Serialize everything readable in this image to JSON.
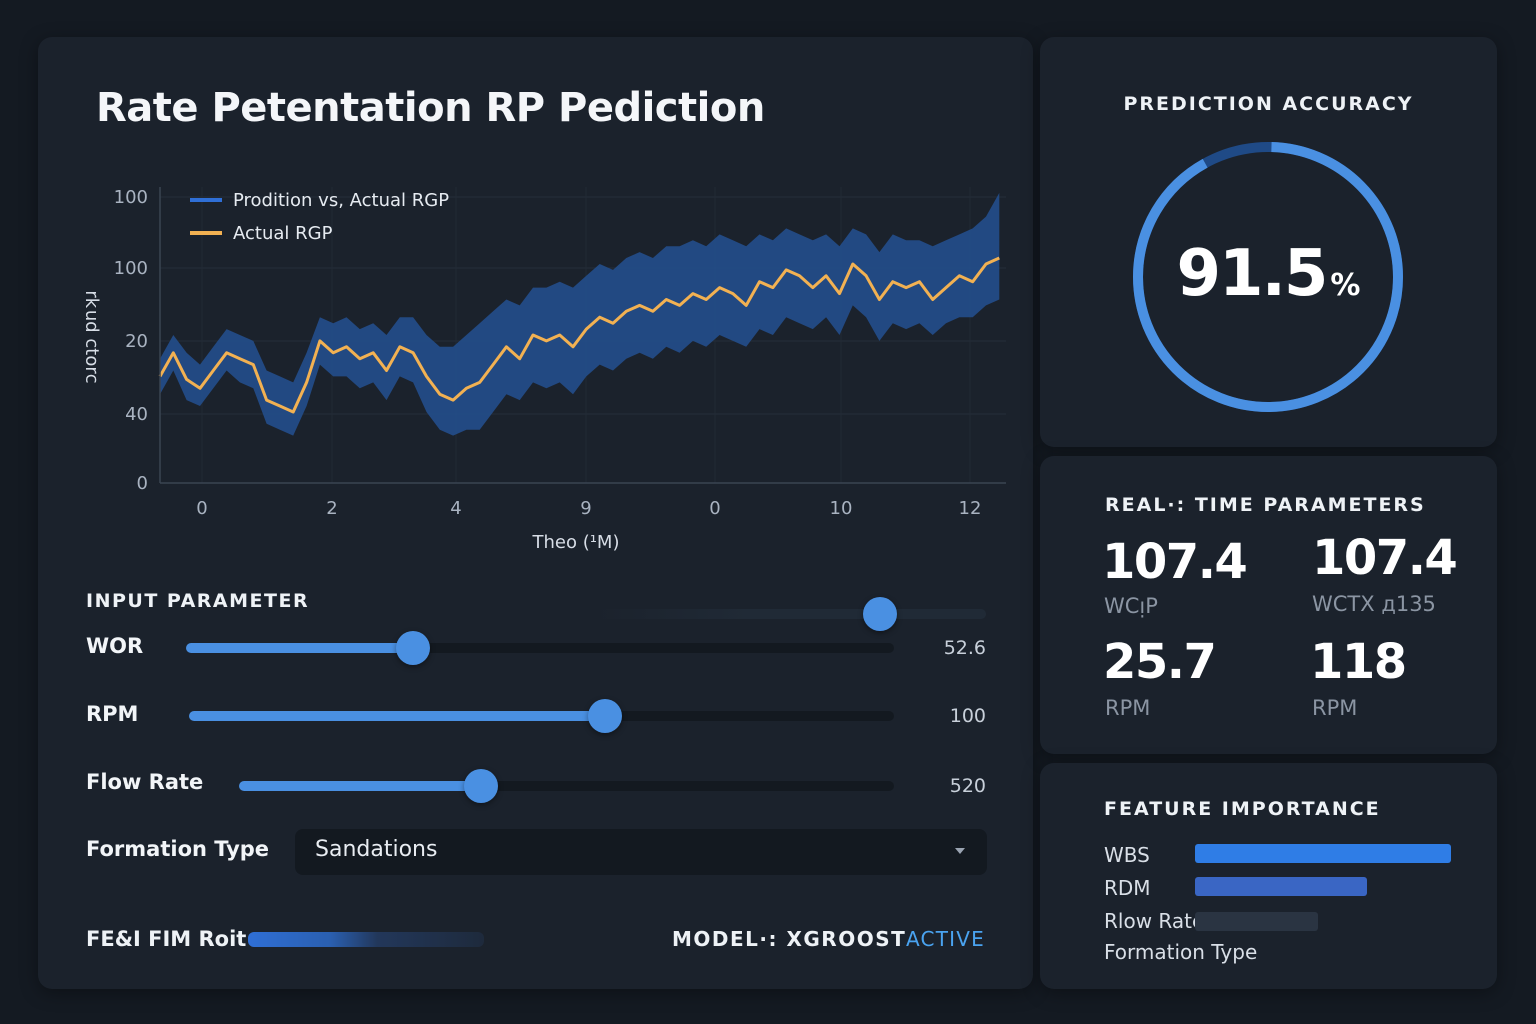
{
  "title": "Rate Petentation RP Pediction",
  "colors": {
    "background": "#141a22",
    "panel": "#1b222c",
    "accent_blue": "#4a90e2",
    "band_blue": "#234e8c",
    "actual_orange": "#f2b152",
    "active_text": "#4aa3f0"
  },
  "chart_data": {
    "type": "line",
    "title": "",
    "xlabel": "Theo (¹M)",
    "ylabel": "ɔɹoʇɔ pnʞɹ",
    "y_tick_labels": [
      "0",
      "40",
      "20",
      "100",
      "100"
    ],
    "x_tick_labels": [
      "0",
      "2",
      "4",
      "9",
      "0",
      "10",
      "12"
    ],
    "grid": true,
    "legend_position": "top-left",
    "legend": [
      "Prodition vs, Actual RGP",
      "Actual RGP"
    ],
    "x_range": [
      0,
      12.7
    ],
    "y_range": [
      0,
      100
    ],
    "series": [
      {
        "name": "Actual RGP",
        "color": "#f2b152",
        "x": [
          0,
          0.2,
          0.4,
          0.6,
          0.8,
          1.0,
          1.2,
          1.4,
          1.6,
          1.8,
          2.0,
          2.2,
          2.4,
          2.6,
          2.8,
          3.0,
          3.2,
          3.4,
          3.6,
          3.8,
          4.0,
          4.2,
          4.4,
          4.6,
          4.8,
          5.0,
          5.2,
          5.4,
          5.6,
          5.8,
          6.0,
          6.2,
          6.4,
          6.6,
          6.8,
          7.0,
          7.2,
          7.4,
          7.6,
          7.8,
          8.0,
          8.2,
          8.4,
          8.6,
          8.8,
          9.0,
          9.2,
          9.4,
          9.6,
          9.8,
          10.0,
          10.2,
          10.4,
          10.6,
          10.8,
          11.0,
          11.2,
          11.4,
          11.6,
          11.8,
          12.0,
          12.2,
          12.4,
          12.6
        ],
        "y": [
          36,
          44,
          35,
          32,
          38,
          44,
          42,
          40,
          28,
          26,
          24,
          34,
          48,
          44,
          46,
          42,
          44,
          38,
          46,
          44,
          36,
          30,
          28,
          32,
          34,
          40,
          46,
          42,
          50,
          48,
          50,
          46,
          52,
          56,
          54,
          58,
          60,
          58,
          62,
          60,
          64,
          62,
          66,
          64,
          60,
          68,
          66,
          72,
          70,
          66,
          70,
          64,
          74,
          70,
          62,
          68,
          66,
          68,
          62,
          66,
          70,
          68,
          74,
          76
        ]
      },
      {
        "name": "Prodition vs, Actual RGP",
        "color": "#234e8c",
        "x": [
          0,
          0.2,
          0.4,
          0.6,
          0.8,
          1.0,
          1.2,
          1.4,
          1.6,
          1.8,
          2.0,
          2.2,
          2.4,
          2.6,
          2.8,
          3.0,
          3.2,
          3.4,
          3.6,
          3.8,
          4.0,
          4.2,
          4.4,
          4.6,
          4.8,
          5.0,
          5.2,
          5.4,
          5.6,
          5.8,
          6.0,
          6.2,
          6.4,
          6.6,
          6.8,
          7.0,
          7.2,
          7.4,
          7.6,
          7.8,
          8.0,
          8.2,
          8.4,
          8.6,
          8.8,
          9.0,
          9.2,
          9.4,
          9.6,
          9.8,
          10.0,
          10.2,
          10.4,
          10.6,
          10.8,
          11.0,
          11.2,
          11.4,
          11.6,
          11.8,
          12.0,
          12.2,
          12.4,
          12.6
        ],
        "y": [
          36,
          44,
          35,
          32,
          38,
          44,
          42,
          40,
          28,
          26,
          24,
          34,
          48,
          44,
          46,
          42,
          44,
          38,
          46,
          44,
          36,
          30,
          28,
          32,
          34,
          40,
          46,
          42,
          50,
          48,
          50,
          46,
          52,
          56,
          54,
          58,
          60,
          58,
          62,
          60,
          64,
          62,
          66,
          64,
          60,
          68,
          66,
          72,
          70,
          66,
          70,
          64,
          74,
          70,
          62,
          68,
          66,
          68,
          62,
          66,
          70,
          68,
          74,
          76
        ],
        "band_upper": [
          42,
          50,
          44,
          40,
          46,
          52,
          50,
          48,
          38,
          36,
          34,
          44,
          56,
          54,
          56,
          52,
          54,
          50,
          56,
          56,
          50,
          46,
          46,
          50,
          54,
          58,
          62,
          60,
          66,
          66,
          68,
          66,
          70,
          74,
          72,
          76,
          78,
          76,
          80,
          80,
          82,
          80,
          84,
          82,
          80,
          84,
          82,
          86,
          84,
          82,
          84,
          80,
          86,
          84,
          78,
          84,
          82,
          82,
          80,
          82,
          84,
          86,
          90,
          98
        ],
        "band_lower": [
          30,
          38,
          28,
          26,
          32,
          38,
          34,
          32,
          20,
          18,
          16,
          26,
          40,
          36,
          36,
          32,
          34,
          28,
          36,
          34,
          24,
          18,
          16,
          18,
          18,
          24,
          30,
          28,
          34,
          32,
          34,
          30,
          36,
          40,
          38,
          42,
          44,
          42,
          46,
          44,
          48,
          46,
          50,
          48,
          46,
          52,
          50,
          56,
          54,
          52,
          56,
          50,
          60,
          56,
          48,
          54,
          52,
          54,
          50,
          54,
          56,
          56,
          60,
          62
        ]
      }
    ]
  },
  "input_parameters": {
    "heading": "INPUT PARAMETER",
    "top_slider": {
      "level": 0.73
    },
    "sliders": [
      {
        "label": "WOR",
        "value": "52.6",
        "level": 0.32
      },
      {
        "label": "RPM",
        "value": "100",
        "level": 0.59
      },
      {
        "label": "Flow Rate",
        "value": "520",
        "level": 0.37
      }
    ],
    "formation": {
      "label": "Formation Type",
      "selected": "Sandations"
    }
  },
  "footer": {
    "left_label": "FE&I FIM Roit",
    "bar_level": 0.3,
    "model_label": "MODEL·: XGROOST",
    "model_status": "ACTIVE"
  },
  "accuracy": {
    "title": "PREDICTION ACCURACY",
    "value": "91.5",
    "unit": "%",
    "percent": 91.5
  },
  "realtime": {
    "title": "REAL·: TIME PARAMETERS",
    "metrics": [
      {
        "value": "107.4",
        "label": "WCᴉP"
      },
      {
        "value": "107.4",
        "label": "WCTX д135"
      },
      {
        "value": "25.7",
        "label": "RPM"
      },
      {
        "value": "118",
        "label": "RPM"
      }
    ]
  },
  "feature_importance": {
    "title": "FEATURE IMPORTANCE",
    "items": [
      {
        "label": "WBS",
        "level": 1.0,
        "color": "#2f7de6"
      },
      {
        "label": "RDM",
        "level": 0.67,
        "color": "#3a66c4"
      },
      {
        "label": "Rlow Rate",
        "level": 0.48,
        "color": "#2a3442"
      },
      {
        "label": "Formation Type",
        "level": 0.0,
        "color": "#2a3442"
      }
    ]
  }
}
